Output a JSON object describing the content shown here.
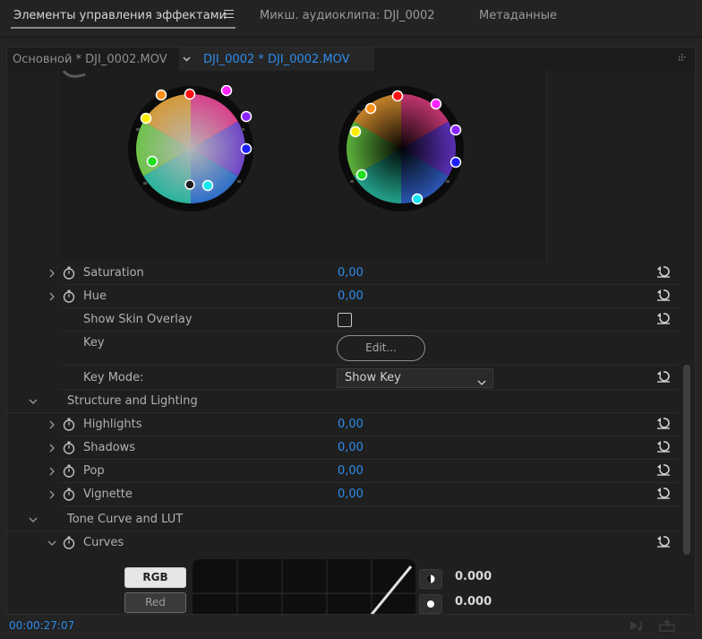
{
  "tabs": [
    {
      "label": "Элементы управления эффектами"
    },
    {
      "label": "Микш. аудиоклипа: DJI_0002"
    },
    {
      "label": "Метаданные"
    }
  ],
  "clip": {
    "master": "Основной * DJI_0002.MOV",
    "sequence": "DJI_0002 * DJI_0002.MOV"
  },
  "params": {
    "saturation": {
      "label": "Saturation",
      "value": "0,00"
    },
    "hue": {
      "label": "Hue",
      "value": "0,00"
    },
    "skin_overlay": {
      "label": "Show Skin Overlay"
    },
    "key": {
      "label": "Key",
      "button": "Edit..."
    },
    "key_mode": {
      "label": "Key Mode:",
      "selected": "Show Key"
    }
  },
  "structure": {
    "title": "Structure and Lighting",
    "highlights": {
      "label": "Highlights",
      "value": "0,00"
    },
    "shadows": {
      "label": "Shadows",
      "value": "0,00"
    },
    "pop": {
      "label": "Pop",
      "value": "0,00"
    },
    "vignette": {
      "label": "Vignette",
      "value": "0,00"
    }
  },
  "tone": {
    "title": "Tone Curve and LUT",
    "curves": {
      "label": "Curves"
    },
    "channels": [
      "RGB",
      "Red"
    ],
    "values": [
      "0.000",
      "0.000"
    ]
  },
  "status": {
    "timecode": "00:00:27:07"
  },
  "colors": {
    "accent": "#2d8ceb",
    "panel": "#1f1f1f",
    "background": "#232323"
  },
  "icons": [
    "menu-icon",
    "chevron-down-icon",
    "grip-icon",
    "chevron-right-icon",
    "stopwatch-icon",
    "reset-icon",
    "caret-down-icon",
    "play-audio-icon",
    "export-icon"
  ]
}
